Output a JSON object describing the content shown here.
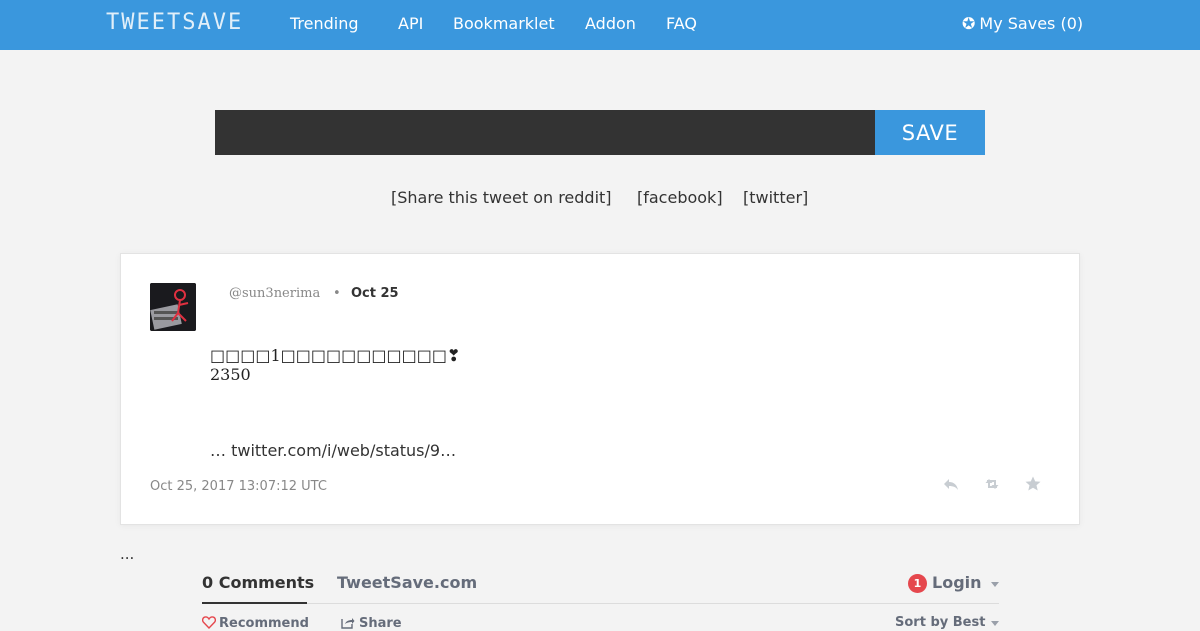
{
  "nav": {
    "brand": "TWEETSAVE",
    "links": [
      "Trending",
      "API",
      "Bookmarklet",
      "Addon",
      "FAQ"
    ],
    "my_saves": "My Saves (0)",
    "my_saves_icon": "star-circle-icon"
  },
  "save_bar": {
    "input_value": "",
    "button_label": "SAVE"
  },
  "share": {
    "reddit": "[Share this tweet on reddit]",
    "facebook": "[facebook]",
    "twitter": "[twitter]"
  },
  "tweet": {
    "handle": "@sun3nerima",
    "separator": "•",
    "date": "Oct 25",
    "text_line1": "□□□□1□□□□□□□□□□□❣",
    "text_line2": "2350",
    "link": "…   twitter.com/i/web/status/9…",
    "timestamp": "Oct 25, 2017 13:07:12 UTC",
    "actions": [
      "reply-icon",
      "retweet-icon",
      "favorite-icon"
    ]
  },
  "after_card_text": "...",
  "comments": {
    "count_label": "0 Comments",
    "site": "TweetSave.com",
    "login_badge": "1",
    "login_label": "Login",
    "recommend_label": "Recommend",
    "share_label": "Share",
    "sort_label": "Sort by Best"
  },
  "colors": {
    "accent": "#3a97dd",
    "input_bg": "#333333",
    "badge": "#e5474d"
  }
}
